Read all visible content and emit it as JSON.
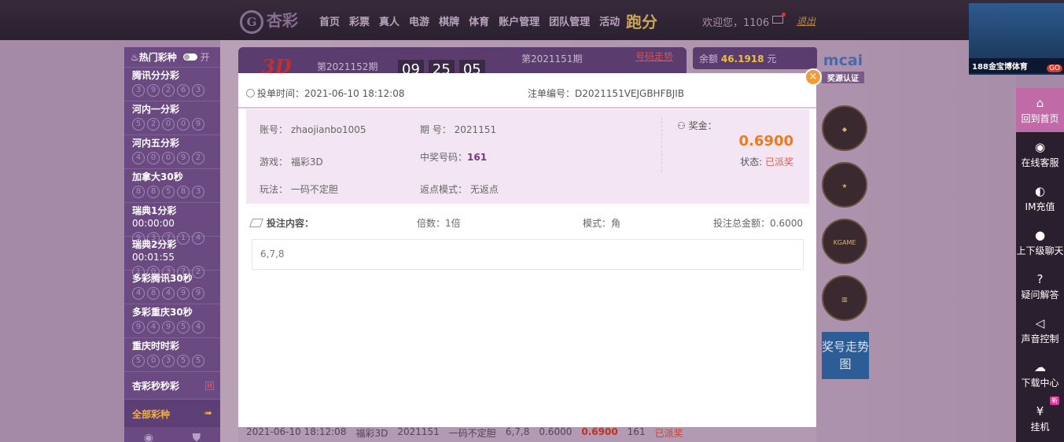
{
  "header": {
    "logo": "杏彩",
    "nav": [
      "首页",
      "彩票",
      "真人",
      "电游",
      "棋牌",
      "体育",
      "账户管理",
      "团队管理",
      "活动"
    ],
    "paofen": "跑分",
    "welcome": "欢迎您，1106",
    "logout": "退出"
  },
  "sidebar": {
    "title": "热门彩种",
    "toggle_label": "开",
    "items": [
      {
        "name": "腾讯分分彩",
        "time": "",
        "balls": [
          "3",
          "9",
          "2",
          "6",
          "3"
        ]
      },
      {
        "name": "河内一分彩",
        "time": "",
        "balls": [
          "5",
          "2",
          "0",
          "0",
          "9"
        ]
      },
      {
        "name": "河内五分彩",
        "time": "",
        "balls": [
          "4",
          "0",
          "0",
          "9",
          "2"
        ]
      },
      {
        "name": "加拿大30秒",
        "time": "",
        "balls": [
          "8",
          "8",
          "5",
          "8",
          "3"
        ]
      },
      {
        "name": "瑞典1分彩",
        "time": "00:00:00",
        "balls": [
          "9",
          "3",
          "7",
          "1",
          "4"
        ]
      },
      {
        "name": "瑞典2分彩",
        "time": "00:01:55",
        "balls": [
          "1",
          "0",
          "3",
          "7",
          "2"
        ]
      },
      {
        "name": "多彩腾讯30秒",
        "time": "",
        "balls": [
          "4",
          "8",
          "4",
          "9",
          "9"
        ]
      },
      {
        "name": "多彩重庆30秒",
        "time": "",
        "balls": [
          "9",
          "4",
          "9",
          "5",
          "4"
        ]
      },
      {
        "name": "重庆时时彩",
        "time": "",
        "balls": [
          "5",
          "0",
          "3",
          "5",
          "5"
        ]
      }
    ],
    "flash": "杏彩秒秒彩",
    "flash_badge": "H",
    "all": "全部彩种"
  },
  "lottery_head": {
    "game_logo": "3D",
    "current_issue": "第2021152期",
    "timer": [
      "09",
      "25",
      "05"
    ],
    "prev_issue": "第2021151期",
    "trend_link": "号码走势"
  },
  "balance": {
    "label": "余额",
    "value": "46.1918",
    "unit": "元"
  },
  "right_badges": {
    "mcai": "mcai",
    "auth": "奖源认证",
    "trend": "奖号走势图"
  },
  "right_bar": [
    {
      "icon": "home-icon",
      "glyph": "⌂",
      "label": "回到首页",
      "active": true
    },
    {
      "icon": "support-icon",
      "glyph": "◉",
      "label": "在线客服",
      "active": false
    },
    {
      "icon": "im-icon",
      "glyph": "◐",
      "label": "IM充值",
      "active": false
    },
    {
      "icon": "chat-icon",
      "glyph": "●",
      "label": "上下级聊天",
      "active": false
    },
    {
      "icon": "help-icon",
      "glyph": "?",
      "label": "疑问解答",
      "active": false
    },
    {
      "icon": "sound-icon",
      "glyph": "◁",
      "label": "声音控制",
      "active": false
    },
    {
      "icon": "download-icon",
      "glyph": "☁",
      "label": "下载中心",
      "active": false
    },
    {
      "icon": "hang-icon",
      "glyph": "¥",
      "label": "挂机",
      "active": false,
      "badge": "新"
    }
  ],
  "ad": {
    "text": "188金宝博体育",
    "go": "GO"
  },
  "modal": {
    "bet_time_label": "投单时间：",
    "bet_time": "2021-06-10 18:12:08",
    "order_label": "注单编号：",
    "order_no": "D2021151VEJGBHFBJIB",
    "account_label": "账号：",
    "account": "zhaojianbo1005",
    "period_label": "期 号：",
    "period": "2021151",
    "game_label": "游戏：",
    "game": "福彩3D",
    "winning_label": "中奖号码：",
    "winning": "161",
    "play_label": "玩法：",
    "play": "一码不定胆",
    "rebate_label": "返点模式：",
    "rebate": "无返点",
    "prize_label": "奖金：",
    "prize": "0.6900",
    "status_label": "状态:",
    "status": "已派奖",
    "content_title": "投注内容：",
    "multiple": "倍数：1倍",
    "mode": "模式：角",
    "total": "投注总金额：0.6000",
    "content": "6,7,8"
  },
  "bottom_row": {
    "time": "2021-06-10 18:12:08",
    "game": "福彩3D",
    "period": "2021151",
    "play": "一码不定胆",
    "content": "6,7,8",
    "amount": "0.6000",
    "prize": "0.6900",
    "winning": "161",
    "status": "已派奖"
  }
}
